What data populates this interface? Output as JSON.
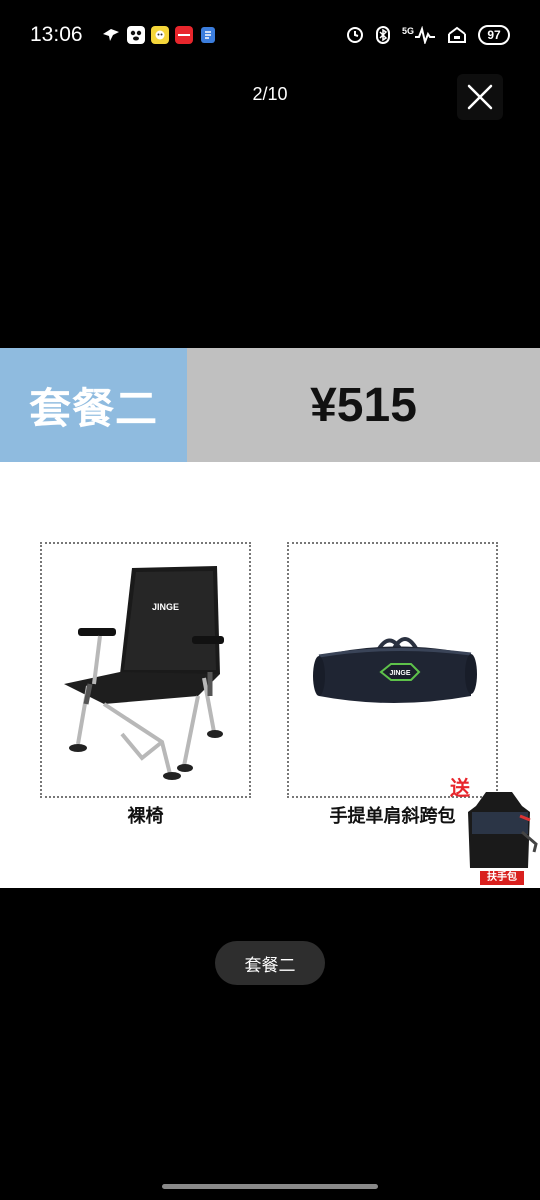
{
  "status_bar": {
    "time": "13:06",
    "network": "5G",
    "battery": "97",
    "notification_icons": [
      "map-pin-icon",
      "panda-app-icon",
      "yellow-app-icon",
      "red-app-icon",
      "file-icon"
    ],
    "system_icons": [
      "alarm-icon",
      "bluetooth-icon",
      "signal-icon",
      "wifi-icon"
    ]
  },
  "viewer": {
    "counter": "2/10",
    "close_icon": "close-icon",
    "caption": "套餐二"
  },
  "image": {
    "banner_title": "套餐二",
    "banner_price": "¥515",
    "banner_title_bg": "#8fbbdf",
    "banner_price_bg": "#c0c0c0",
    "products": [
      {
        "label": "裸椅",
        "image": "chair-image",
        "brand": "JINGE"
      },
      {
        "label": "手提单肩斜跨包",
        "image": "bag-image",
        "brand": "JINGE"
      }
    ],
    "gift": {
      "badge": "送",
      "label": "扶手包"
    }
  }
}
